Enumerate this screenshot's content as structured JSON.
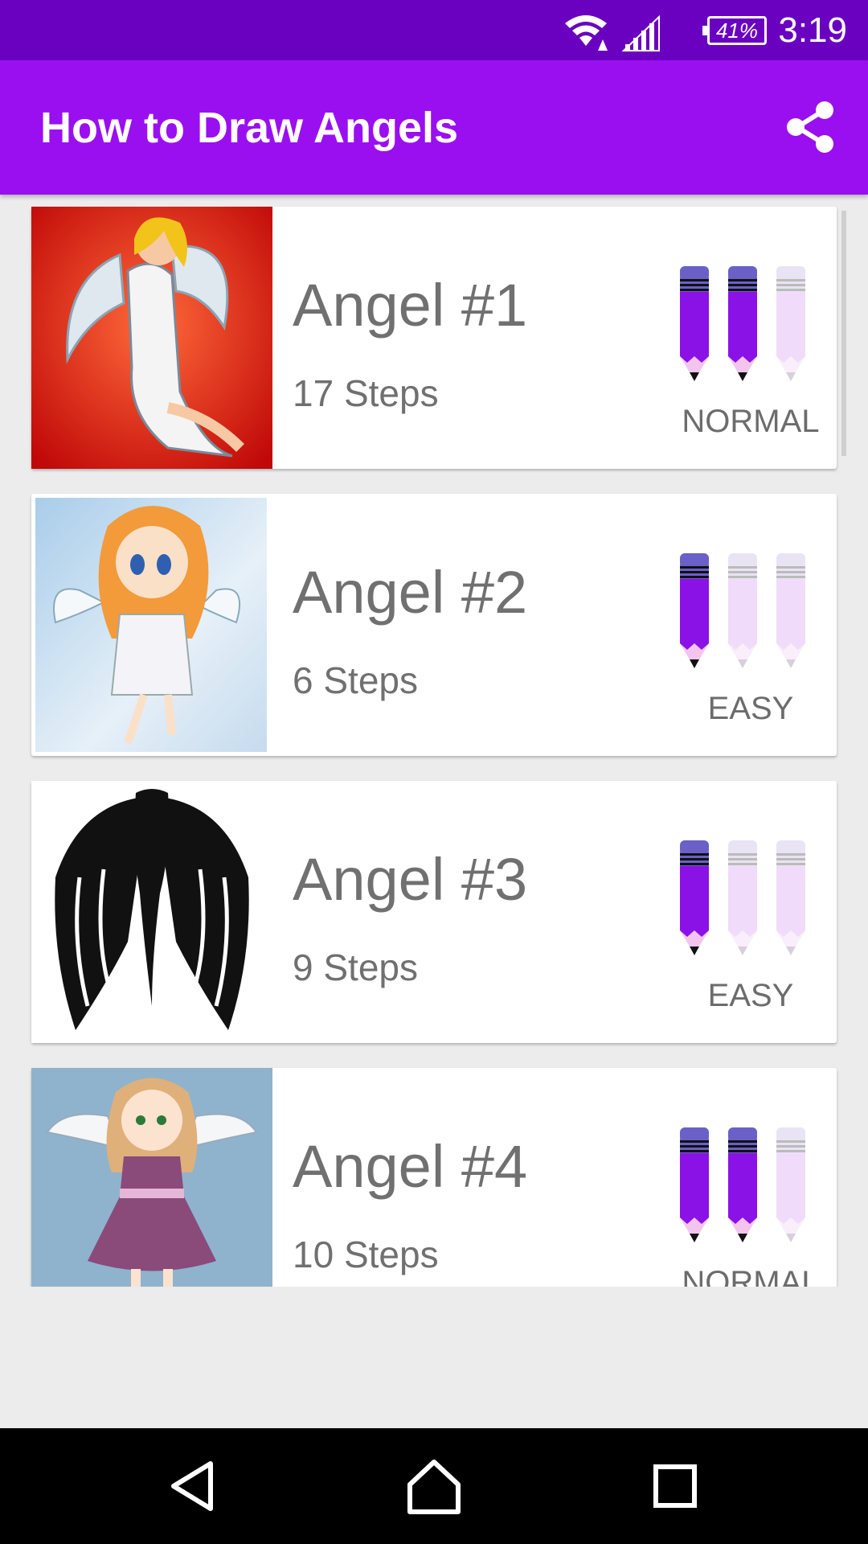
{
  "status_bar": {
    "battery": "41%",
    "time": "3:19"
  },
  "app_bar": {
    "title": "How to Draw Angels",
    "share_icon": "share-icon"
  },
  "items": [
    {
      "title": "Angel #1",
      "steps": "17 Steps",
      "difficulty": "NORMAL",
      "level": 2
    },
    {
      "title": "Angel #2",
      "steps": "6 Steps",
      "difficulty": "EASY",
      "level": 1
    },
    {
      "title": "Angel #3",
      "steps": "9 Steps",
      "difficulty": "EASY",
      "level": 1
    },
    {
      "title": "Angel #4",
      "steps": "10 Steps",
      "difficulty": "NORMAL",
      "level": 2
    }
  ],
  "colors": {
    "status_bar": "#6a00c0",
    "app_bar": "#9a0ff0",
    "pencil_active": "#8a12e6",
    "pencil_inactive": "#f0dcfa"
  },
  "nav_bar": {
    "icons": [
      "back-icon",
      "home-icon",
      "recents-icon"
    ]
  }
}
